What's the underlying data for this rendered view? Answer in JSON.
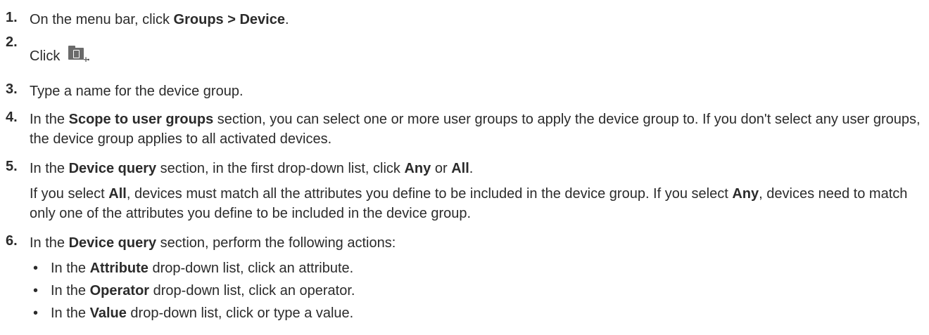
{
  "steps": [
    {
      "num": "1.",
      "parts": [
        "On the menu bar, click ",
        "Groups > Device",
        "."
      ]
    },
    {
      "num": "2.",
      "parts": [
        "Click ",
        "."
      ],
      "icon": "add-device-group-icon"
    },
    {
      "num": "3.",
      "parts": [
        "Type a name for the device group."
      ]
    },
    {
      "num": "4.",
      "parts": [
        "In the ",
        "Scope to user groups",
        " section, you can select one or more user groups to apply the device group to. If you don't select any user groups, the device group applies to all activated devices."
      ]
    },
    {
      "num": "5.",
      "parts": [
        "In the ",
        "Device query",
        " section, in the first drop-down list, click ",
        "Any",
        " or ",
        "All",
        "."
      ],
      "para": [
        "If you select ",
        "All",
        ", devices must match all the attributes you define to be included in the device group. If you select ",
        "Any",
        ", devices need to match only one of the attributes you define to be included in the device group."
      ]
    },
    {
      "num": "6.",
      "parts": [
        "In the ",
        "Device query",
        " section, perform the following actions:"
      ],
      "bullets": [
        [
          "In the ",
          "Attribute",
          " drop-down list, click an attribute."
        ],
        [
          "In the ",
          "Operator",
          " drop-down list, click an operator."
        ],
        [
          "In the ",
          "Value",
          " drop-down list, click or type a value."
        ]
      ]
    }
  ],
  "bullet_glyph": "•"
}
